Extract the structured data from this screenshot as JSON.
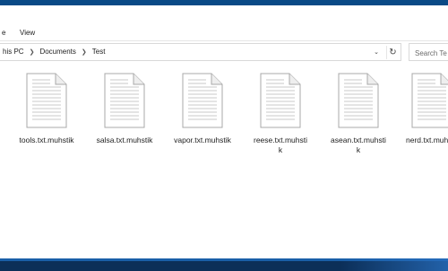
{
  "ribbon": {
    "tabs": [
      {
        "label": "e"
      },
      {
        "label": "View"
      }
    ]
  },
  "address_bar": {
    "crumbs": [
      "his PC",
      "Documents",
      "Test"
    ],
    "dropdown_icon": "chevron-down-icon",
    "refresh_icon": "refresh-icon"
  },
  "search": {
    "placeholder": "Search Te"
  },
  "files": [
    {
      "name": "tools.txt.muhstik",
      "icon": "text-document-icon"
    },
    {
      "name": "salsa.txt.muhstik",
      "icon": "text-document-icon"
    },
    {
      "name": "vapor.txt.muhstik",
      "icon": "text-document-icon"
    },
    {
      "name": "reese.txt.muhstik",
      "icon": "text-document-icon"
    },
    {
      "name": "asean.txt.muhstik",
      "icon": "text-document-icon"
    },
    {
      "name": "nerd.txt.muhstik",
      "icon": "text-document-icon"
    }
  ],
  "colors": {
    "title_bar": "#0a4a86",
    "taskbar": "#0c2f58",
    "background": "#ffffff"
  }
}
